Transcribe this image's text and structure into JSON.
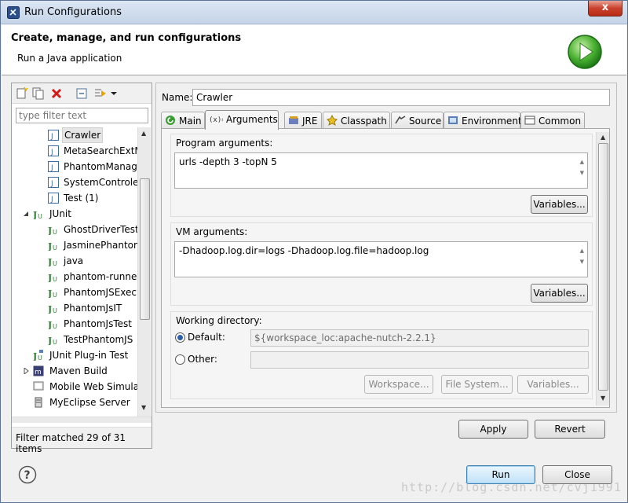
{
  "window": {
    "title": "Run Configurations",
    "close_glyph": "x"
  },
  "banner": {
    "title": "Create, manage, and run configurations",
    "subtitle": "Run a Java application",
    "icon": "run-play-icon"
  },
  "left": {
    "filter_placeholder": "type filter text",
    "tree": [
      {
        "label": "Crawler",
        "icon": "java-app-icon",
        "selected": true
      },
      {
        "label": "MetaSearchExtMai",
        "icon": "java-app-icon"
      },
      {
        "label": "PhantomManager",
        "icon": "java-app-icon"
      },
      {
        "label": "SystemControler",
        "icon": "java-app-icon"
      },
      {
        "label": "Test (1)",
        "icon": "java-app-icon"
      },
      {
        "label": "JUnit",
        "icon": "junit-icon",
        "expanded": true
      },
      {
        "label": "GhostDriverTest",
        "icon": "junit-icon"
      },
      {
        "label": "JasminePhantomJS",
        "icon": "junit-icon"
      },
      {
        "label": "java",
        "icon": "junit-icon"
      },
      {
        "label": "phantom-runner",
        "icon": "junit-icon"
      },
      {
        "label": "PhantomJSExecutor",
        "icon": "junit-icon"
      },
      {
        "label": "PhantomJsIT",
        "icon": "junit-icon"
      },
      {
        "label": "PhantomJsTest",
        "icon": "junit-icon"
      },
      {
        "label": "TestPhantomJS",
        "icon": "junit-icon"
      },
      {
        "label": "JUnit Plug-in Test",
        "icon": "junit-plugin-icon"
      },
      {
        "label": "Maven Build",
        "icon": "maven-icon",
        "collapsed": true
      },
      {
        "label": "Mobile Web Simulator",
        "icon": "mobile-web-icon"
      },
      {
        "label": "MyEclipse Server",
        "icon": "server-icon"
      }
    ],
    "filter_status": "Filter matched 29 of 31 items"
  },
  "right": {
    "name_label": "Name:",
    "name_value": "Crawler",
    "tabs": [
      {
        "label": "Main",
        "icon": "main-tab-icon"
      },
      {
        "label": "Arguments",
        "icon": "arguments-tab-icon",
        "active": true
      },
      {
        "label": "JRE",
        "icon": "jre-icon"
      },
      {
        "label": "Classpath",
        "icon": "classpath-icon"
      },
      {
        "label": "Source",
        "icon": "source-icon"
      },
      {
        "label": "Environment",
        "icon": "environment-icon"
      },
      {
        "label": "Common",
        "icon": "common-icon"
      }
    ],
    "program_args": {
      "title": "Program arguments:",
      "value": "urls -depth 3 -topN 5",
      "variables_label": "Variables..."
    },
    "vm_args": {
      "title": "VM arguments:",
      "value": "-Dhadoop.log.dir=logs -Dhadoop.log.file=hadoop.log",
      "variables_label": "Variables..."
    },
    "working_dir": {
      "title": "Working directory:",
      "default_label": "Default:",
      "default_value": "${workspace_loc:apache-nutch-2.2.1}",
      "other_label": "Other:",
      "other_value": "",
      "workspace_label": "Workspace...",
      "filesystem_label": "File System...",
      "variables_label": "Variables..."
    },
    "apply_label": "Apply",
    "revert_label": "Revert"
  },
  "footer": {
    "run_label": "Run",
    "close_label": "Close",
    "watermark": "http://blog.csdn.net/cvj1991"
  }
}
